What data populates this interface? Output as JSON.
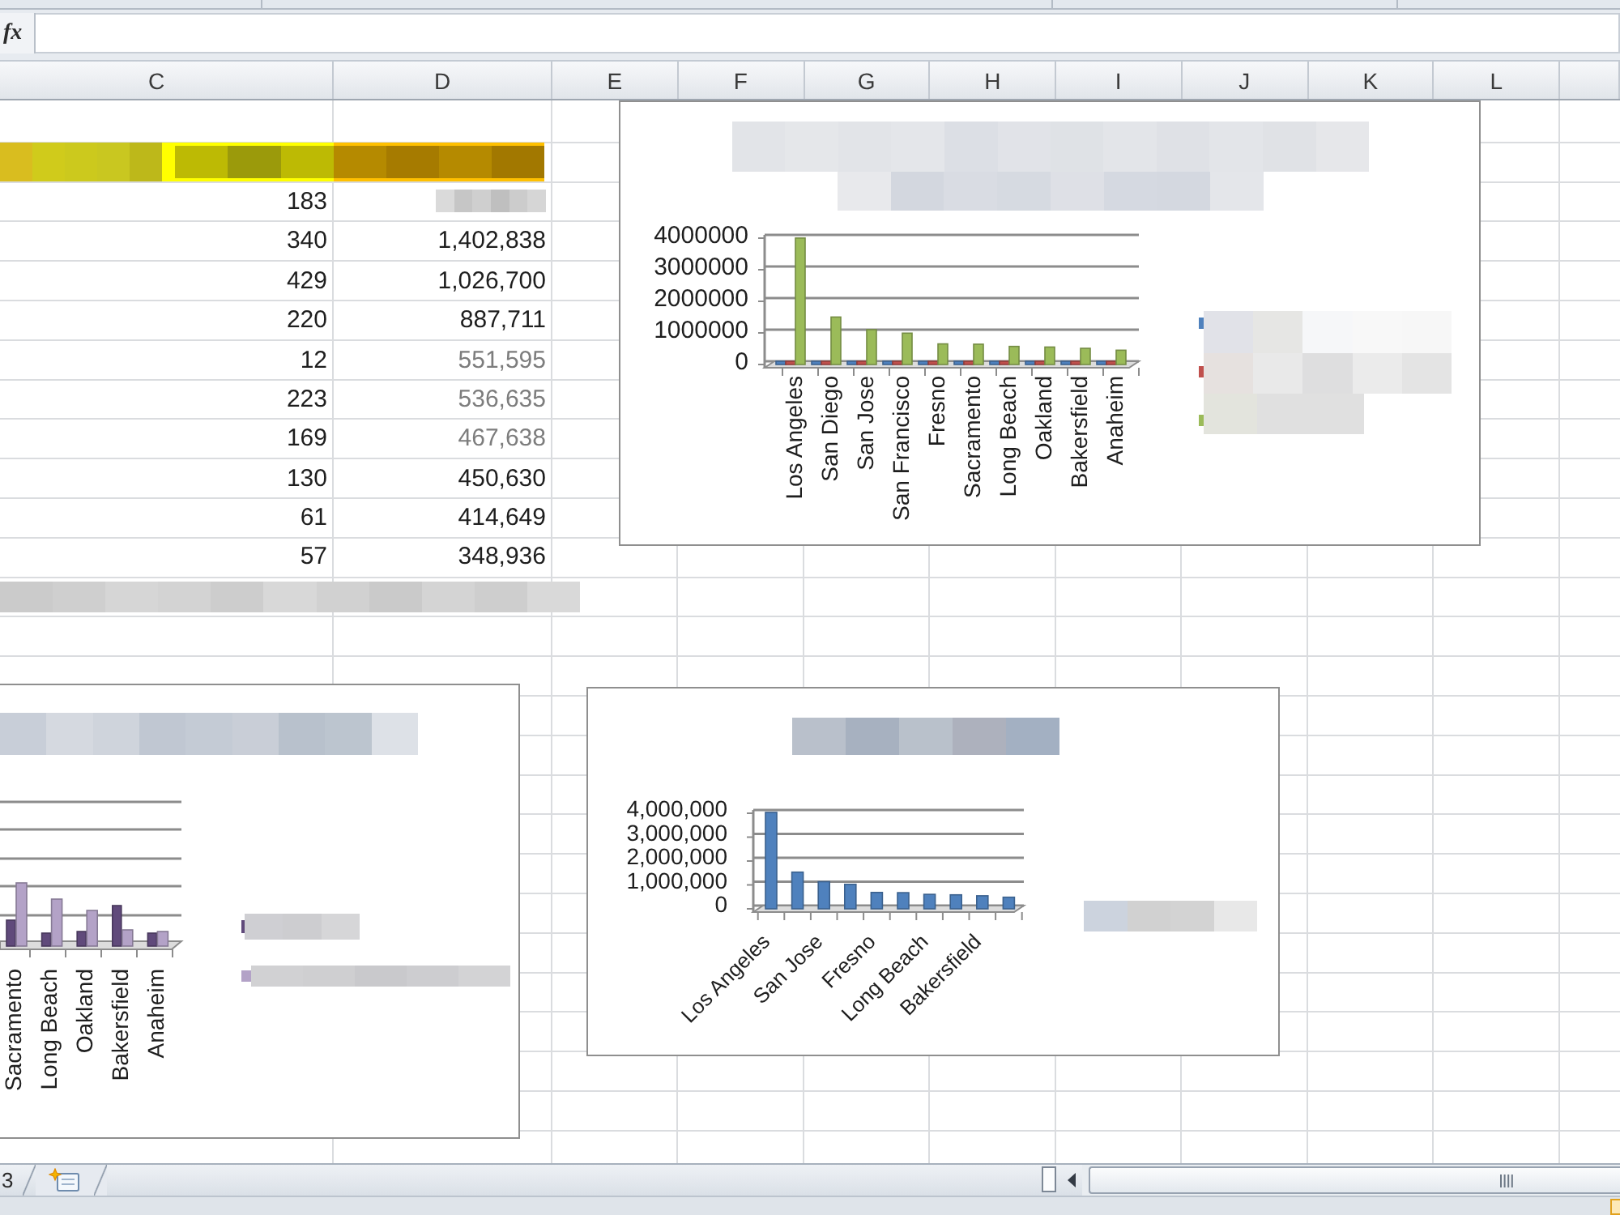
{
  "formula_bar": {
    "function_label": "fx"
  },
  "column_headers": [
    "C",
    "D",
    "E",
    "F",
    "G",
    "H",
    "I",
    "J",
    "K",
    "L"
  ],
  "sheet": {
    "highlight_row": {
      "cells": [
        {
          "color": "#ffff00"
        },
        {
          "color": "#ffc000"
        }
      ]
    },
    "rows": [
      {
        "column_c": "183",
        "column_d": {
          "kind": "pixelated"
        }
      },
      {
        "column_c": "340",
        "column_d": {
          "kind": "number",
          "text": "1,402,838",
          "greyed": false
        }
      },
      {
        "column_c": "429",
        "column_d": {
          "kind": "number",
          "text": "1,026,700",
          "greyed": false
        }
      },
      {
        "column_c": "220",
        "column_d": {
          "kind": "number",
          "text": "887,711",
          "greyed": false
        }
      },
      {
        "column_c": "12",
        "column_d": {
          "kind": "number",
          "text": "551,595",
          "greyed": true
        }
      },
      {
        "column_c": "223",
        "column_d": {
          "kind": "number",
          "text": "536,635",
          "greyed": true
        }
      },
      {
        "column_c": "169",
        "column_d": {
          "kind": "number",
          "text": "467,638",
          "greyed": true
        }
      },
      {
        "column_c": "130",
        "column_d": {
          "kind": "number",
          "text": "450,630",
          "greyed": false
        }
      },
      {
        "column_c": "61",
        "column_d": {
          "kind": "number",
          "text": "414,649",
          "greyed": false
        }
      },
      {
        "column_c": "57",
        "column_d": {
          "kind": "number",
          "text": "348,936",
          "greyed": false
        }
      }
    ]
  },
  "chart_1": {
    "chart_data": {
      "type": "bar",
      "categories": [
        "Los Angeles",
        "San Diego",
        "San Jose",
        "San Francisco",
        "Fresno",
        "Sacramento",
        "Long Beach",
        "Oakland",
        "Bakersfield",
        "Anaheim"
      ],
      "series": [
        {
          "color": "#4f81bd",
          "values": [
            0,
            0,
            0,
            0,
            0,
            0,
            0,
            0,
            0,
            0
          ]
        },
        {
          "color": "#c0504d",
          "values": [
            0,
            0,
            0,
            0,
            0,
            0,
            0,
            0,
            0,
            0
          ]
        },
        {
          "color": "#9bbb59",
          "values": [
            3900000,
            1400000,
            1000000,
            890000,
            550000,
            540000,
            470000,
            450000,
            410000,
            350000
          ]
        }
      ],
      "ylim": [
        0,
        4000000
      ],
      "yticks": [
        0,
        1000000,
        2000000,
        3000000,
        4000000
      ],
      "grid": true
    }
  },
  "chart_2": {
    "category_labels": [
      "Sacramento",
      "Long Beach",
      "Oakland",
      "Bakersfield",
      "Anaheim"
    ],
    "legend": [
      {
        "color": "#604a7b"
      },
      {
        "color": "#b3a2c7"
      }
    ]
  },
  "chart_3": {
    "chart_data": {
      "type": "bar",
      "categories": [
        "Los Angeles",
        null,
        "San Jose",
        null,
        "Fresno",
        null,
        "Long Beach",
        null,
        "Bakersfield",
        null
      ],
      "series": [
        {
          "color": "#4f81bd",
          "values": [
            3900000,
            1400000,
            1000000,
            890000,
            550000,
            540000,
            470000,
            450000,
            410000,
            350000
          ]
        }
      ],
      "ylim": [
        0,
        4000000
      ],
      "yticks": [
        {
          "value": 0,
          "label": "0"
        },
        {
          "value": 1000000,
          "label": "1,000,000"
        },
        {
          "value": 2000000,
          "label": "2,000,000"
        },
        {
          "value": 3000000,
          "label": "3,000,000"
        },
        {
          "value": 4000000,
          "label": "4,000,000"
        }
      ],
      "grid": true
    }
  },
  "sheet_tabs": [
    {
      "label": "3",
      "selected": false
    }
  ]
}
